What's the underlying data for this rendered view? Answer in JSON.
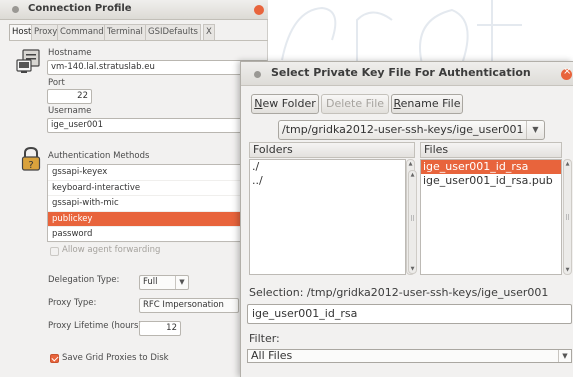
{
  "connection_profile": {
    "title": "Connection Profile",
    "tabs": [
      "Host",
      "Proxy",
      "Commands",
      "Terminal",
      "GSIDefaults",
      "X"
    ],
    "hostname_label": "Hostname",
    "hostname_value": "vm-140.lal.stratuslab.eu",
    "port_label": "Port",
    "port_value": "22",
    "username_label": "Username",
    "username_value": "ige_user001",
    "auth_methods_label": "Authentication Methods",
    "auth_methods": [
      "gssapi-keyex",
      "keyboard-interactive",
      "gssapi-with-mic",
      "publickey",
      "password"
    ],
    "allow_agent_forwarding_label": "Allow agent forwarding",
    "delegation_type_label": "Delegation Type:",
    "delegation_type_value": "Full",
    "proxy_type_label": "Proxy Type:",
    "proxy_type_value": "RFC Impersonation",
    "proxy_lifetime_label": "Proxy Lifetime (hours):",
    "proxy_lifetime_value": "12",
    "save_grid_proxies_label": "Save Grid Proxies to Disk"
  },
  "dialog": {
    "title": "Select Private Key File For Authentication",
    "new_folder_label": "New Folder",
    "delete_file_label": "Delete File",
    "rename_file_label": "Rename File",
    "current_path": "/tmp/gridka2012-user-ssh-keys/ige_user001",
    "folders_header": "Folders",
    "files_header": "Files",
    "folders": [
      "./",
      "../"
    ],
    "files": [
      "ige_user001_id_rsa",
      "ige_user001_id_rsa.pub"
    ],
    "selection_label": "Selection: /tmp/gridka2012-user-ssh-keys/ige_user001",
    "selection_value": "ige_user001_id_rsa",
    "filter_label": "Filter:",
    "filter_value": "All Files"
  },
  "colors": {
    "accent": "#e8643c",
    "window_bg": "#f2f1f0"
  }
}
